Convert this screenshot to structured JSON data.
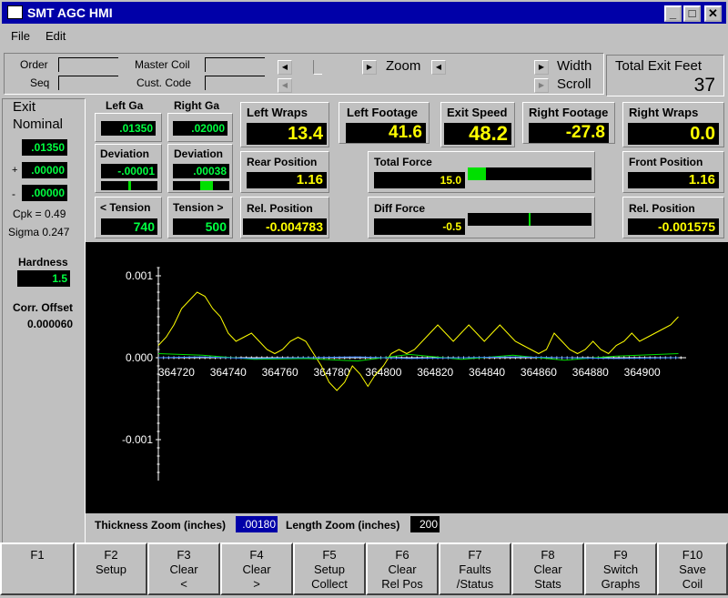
{
  "window": {
    "title": "SMT AGC HMI"
  },
  "menu": [
    "File",
    "Edit"
  ],
  "header": {
    "order_label": "Order",
    "seq_label": "Seq",
    "master_coil_label": "Master Coil",
    "cust_code_label": "Cust. Code",
    "zoom_label": "Zoom",
    "width_label": "Width",
    "scroll_label": "Scroll",
    "total_exit_feet_label": "Total Exit Feet",
    "total_exit_feet_value": "37"
  },
  "exit": {
    "title": "Exit",
    "nominal_label": "Nominal",
    "nominal_value": ".01350",
    "plus_label": "+",
    "plus_value": ".00000",
    "minus_label": "-",
    "minus_value": ".00000",
    "cpk": "Cpk = 0.49",
    "sigma": "Sigma 0.247",
    "hardness_label": "Hardness",
    "hardness_value": "1.5",
    "corr_offset_label": "Corr. Offset",
    "corr_offset_value": "0.000060"
  },
  "gauges": {
    "left_ga_label": "Left Ga",
    "left_ga_value": ".01350",
    "right_ga_label": "Right Ga",
    "right_ga_value": ".02000",
    "deviation_label": "Deviation",
    "left_dev_value": "-.00001",
    "right_dev_value": ".00038",
    "left_dev_marker": 0.5,
    "right_dev_marker": 0.6,
    "left_tension_label": "< Tension",
    "left_tension_value": "740",
    "right_tension_label": "Tension >",
    "right_tension_value": "500"
  },
  "readouts": {
    "left_wraps_label": "Left Wraps",
    "left_wraps_value": "13.4",
    "left_footage_label": "Left Footage",
    "left_footage_value": "41.6",
    "exit_speed_label": "Exit Speed",
    "exit_speed_value": "48.2",
    "right_footage_label": "Right Footage",
    "right_footage_value": "-27.8",
    "right_wraps_label": "Right Wraps",
    "right_wraps_value": "0.0",
    "rear_position_label": "Rear Position",
    "rear_position_value": "1.16",
    "front_position_label": "Front Position",
    "front_position_value": "1.16",
    "rel_position_label": "Rel. Position",
    "rear_rel_value": "-0.004783",
    "front_rel_value": "-0.001575",
    "total_force_label": "Total Force",
    "total_force_value": "15.0",
    "total_force_fill": 0.15,
    "diff_force_label": "Diff Force",
    "diff_force_value": "-0.5",
    "diff_force_marker": 0.5
  },
  "zoom": {
    "thickness_label": "Thickness Zoom (inches)",
    "thickness_value": ".00180",
    "length_label": "Length Zoom (inches)",
    "length_value": "200"
  },
  "chart_data": {
    "type": "line",
    "x_ticks": [
      "364720",
      "364740",
      "364760",
      "364780",
      "364800",
      "364820",
      "364840",
      "364860",
      "364880",
      "364900"
    ],
    "y_ticks": [
      "0.001",
      "0.000",
      "-0.001"
    ],
    "xlim": [
      364713,
      364917
    ],
    "ylim": [
      -0.0015,
      0.0011
    ],
    "series": [
      {
        "color": "#ffff00",
        "x": [
          364713,
          364716,
          364719,
          364722,
          364725,
          364728,
          364731,
          364734,
          364737,
          364740,
          364743,
          364746,
          364749,
          364752,
          364755,
          364758,
          364761,
          364764,
          364767,
          364770,
          364773,
          364776,
          364779,
          364782,
          364785,
          364788,
          364791,
          364794,
          364797,
          364800,
          364803,
          364806,
          364809,
          364812,
          364815,
          364818,
          364821,
          364824,
          364827,
          364830,
          364833,
          364836,
          364839,
          364842,
          364845,
          364848,
          364851,
          364854,
          364857,
          364860,
          364863,
          364866,
          364869,
          364872,
          364875,
          364878,
          364881,
          364884,
          364887,
          364890,
          364893,
          364896,
          364899,
          364902,
          364905,
          364908,
          364911,
          364914
        ],
        "y": [
          0.00015,
          0.00025,
          0.0004,
          0.0006,
          0.0007,
          0.0008,
          0.00075,
          0.0006,
          0.0005,
          0.0003,
          0.0002,
          0.00025,
          0.0003,
          0.0002,
          0.0001,
          5e-05,
          0.0001,
          0.0002,
          0.00025,
          0.0002,
          5e-05,
          -0.0001,
          -0.0003,
          -0.0004,
          -0.0003,
          -0.0001,
          -0.0002,
          -0.00035,
          -0.0002,
          -0.0001,
          5e-05,
          0.0001,
          5e-05,
          0.0001,
          0.0002,
          0.0003,
          0.0004,
          0.0003,
          0.0002,
          0.0003,
          0.0004,
          0.0003,
          0.0002,
          0.0003,
          0.0004,
          0.0003,
          0.0002,
          0.00015,
          0.0001,
          5e-05,
          0.0001,
          0.0003,
          0.0002,
          0.0001,
          5e-05,
          0.0001,
          0.0002,
          0.0001,
          5e-05,
          0.00015,
          0.0002,
          0.0003,
          0.0002,
          0.00025,
          0.0003,
          0.00035,
          0.0004,
          0.0005
        ]
      },
      {
        "color": "#00e000",
        "x": [
          364713,
          364730,
          364750,
          364770,
          364790,
          364810,
          364830,
          364850,
          364870,
          364890,
          364914
        ],
        "y": [
          5e-05,
          3e-05,
          -2e-05,
          -1e-05,
          -4e-05,
          4e-05,
          -2e-05,
          3e-05,
          -3e-05,
          2e-05,
          5e-05
        ]
      },
      {
        "color": "#3080ff",
        "x": [
          364713,
          364730,
          364750,
          364770,
          364790,
          364810,
          364830,
          364850,
          364870,
          364890,
          364914
        ],
        "y": [
          0.0,
          1e-05,
          -1e-05,
          0.0,
          1e-05,
          -1e-05,
          0.0,
          1e-05,
          0.0,
          -1e-05,
          0.0
        ]
      }
    ]
  },
  "fkeys": [
    {
      "key": "F1",
      "label": ""
    },
    {
      "key": "F2",
      "label": "Setup"
    },
    {
      "key": "F3",
      "label": "Clear\n<"
    },
    {
      "key": "F4",
      "label": "Clear\n>"
    },
    {
      "key": "F5",
      "label": "Setup\nCollect"
    },
    {
      "key": "F6",
      "label": "Clear\nRel Pos"
    },
    {
      "key": "F7",
      "label": "Faults\n/Status"
    },
    {
      "key": "F8",
      "label": "Clear\nStats"
    },
    {
      "key": "F9",
      "label": "Switch\nGraphs"
    },
    {
      "key": "F10",
      "label": "Save\nCoil"
    }
  ]
}
